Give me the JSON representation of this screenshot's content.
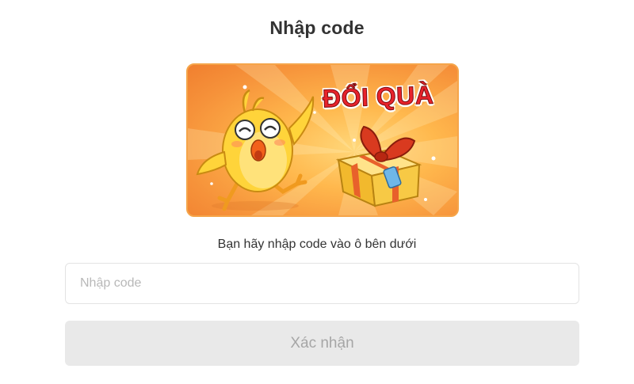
{
  "dialog": {
    "title": "Nhập code",
    "banner": {
      "text": "ĐỔI QUÀ"
    },
    "prompt": "Bạn hãy nhập code vào ô bên dưới",
    "code_input": {
      "value": "",
      "placeholder": "Nhập code"
    },
    "confirm_button": {
      "label": "Xác nhận",
      "enabled": false
    }
  },
  "colors": {
    "banner_orange": "#f6923a",
    "banner_text_red": "#e8232b",
    "button_disabled_bg": "#e9e9e9",
    "button_disabled_text": "#a6a6a6"
  }
}
